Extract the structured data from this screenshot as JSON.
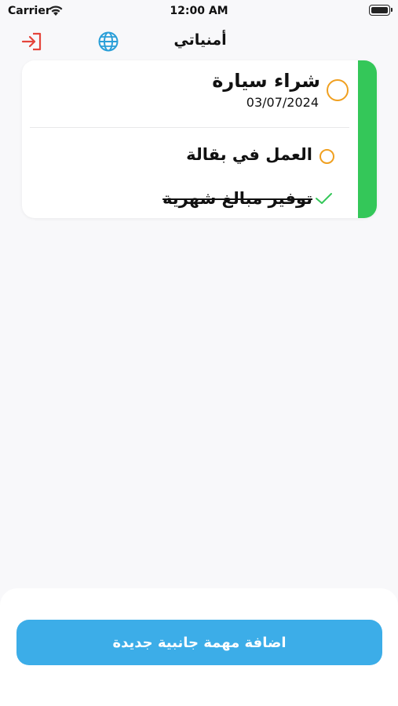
{
  "status_bar": {
    "carrier": "Carrier",
    "time": "12:00 AM"
  },
  "nav": {
    "title": "أمنياتي",
    "logout_icon": "logout-icon",
    "language_icon": "globe-icon"
  },
  "goal": {
    "title": "شراء سيارة",
    "date": "03/07/2024",
    "status": "pending",
    "stripe_color": "#34c759"
  },
  "tasks": [
    {
      "title": "العمل في بقالة",
      "status": "pending"
    },
    {
      "title": "توفير مبالغ شهرية",
      "status": "done"
    }
  ],
  "actions": {
    "add_task_label": "اضافة مهمة جانبية جديدة"
  },
  "colors": {
    "accent": "#3cade8",
    "pending": "#f0a020",
    "done": "#34c759",
    "logout": "#e5443b"
  }
}
